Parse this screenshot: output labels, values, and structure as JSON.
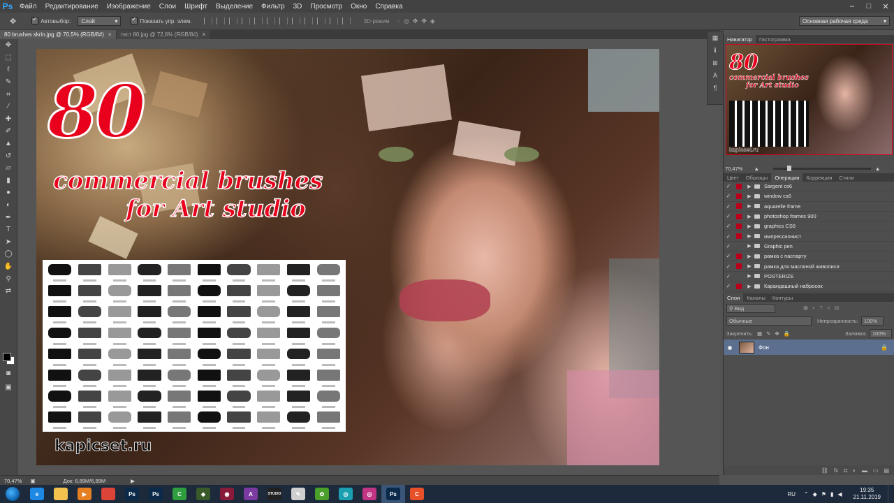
{
  "menubar": {
    "logo": "Ps",
    "items": [
      "Файл",
      "Редактирование",
      "Изображение",
      "Слои",
      "Шрифт",
      "Выделение",
      "Фильтр",
      "3D",
      "Просмотр",
      "Окно",
      "Справка"
    ],
    "controls": [
      "–",
      "□",
      "✕"
    ]
  },
  "options": {
    "autoselect_label": "Автовыбор:",
    "autoselect_value": "Слой",
    "show_controls_label": "Показать упр. элем.",
    "mode_3d": "3D-режим",
    "workspace": "Основная рабочая среда"
  },
  "tabs": [
    {
      "label": "80 brushes skrin.jpg @ 70,5% (RGB/8#)",
      "close": "×"
    },
    {
      "label": "тест 80.jpg @ 72,6% (RGB/8#)",
      "close": "×"
    }
  ],
  "artwork": {
    "big_number": "80",
    "line1": "commercial brushes",
    "line2": "for Art studio",
    "url": "kapicset.ru"
  },
  "panels": {
    "navigator_tabs": [
      "Навигатор",
      "Гистограмма"
    ],
    "navigator_zoom": "70,47%",
    "nav_thumb": {
      "number": "80",
      "line1": "commercial brushes",
      "line2": "for Art studio",
      "url": "kapicset.ru"
    },
    "actions_tabs": [
      "Цвет",
      "Образцы",
      "Операции",
      "Коррекция",
      "Стили"
    ],
    "actions": [
      {
        "label": "Sargent cs6",
        "checked": true,
        "marked": true
      },
      {
        "label": "window cs6",
        "checked": true,
        "marked": true
      },
      {
        "label": "aquarelle frame",
        "checked": true,
        "marked": true
      },
      {
        "label": "photoshop frames 900",
        "checked": true,
        "marked": true
      },
      {
        "label": "graphics CS6",
        "checked": true,
        "marked": true
      },
      {
        "label": "импрессионист",
        "checked": true,
        "marked": true
      },
      {
        "label": "Graphic pen",
        "checked": true,
        "marked": false
      },
      {
        "label": "рамка с паспарту",
        "checked": true,
        "marked": true
      },
      {
        "label": "рамка для масляной живописи",
        "checked": true,
        "marked": true
      },
      {
        "label": "POSTERIZE",
        "checked": true,
        "marked": false
      },
      {
        "label": "Карандашный набросок",
        "checked": true,
        "marked": true
      }
    ],
    "layers_tabs": [
      "Слои",
      "Каналы",
      "Контуры"
    ],
    "layer_kind": "Вид",
    "blend_mode": "Обычные",
    "opacity_label": "Непрозрачность:",
    "opacity_value": "100%",
    "lock_label": "Закрепить:",
    "fill_label": "Заливка:",
    "fill_value": "100%",
    "layer_name": "Фон"
  },
  "status": {
    "zoom": "70,47%",
    "doc": "Док: 6,89M/6,89M"
  },
  "taskbar": {
    "apps": [
      {
        "name": "ie",
        "label": "e",
        "color": "#1e88e5"
      },
      {
        "name": "explorer",
        "label": "",
        "color": "#f2c14e"
      },
      {
        "name": "media",
        "label": "▶",
        "color": "#e67e22"
      },
      {
        "name": "chrome",
        "label": "",
        "color": "#db4437"
      },
      {
        "name": "ps1",
        "label": "Ps",
        "color": "#0b2a4a"
      },
      {
        "name": "ps2",
        "label": "Ps",
        "color": "#0b2a4a"
      },
      {
        "name": "camtasia",
        "label": "C",
        "color": "#2e9e3e"
      },
      {
        "name": "app8",
        "label": "◆",
        "color": "#3a5a2a"
      },
      {
        "name": "app9",
        "label": "◉",
        "color": "#8a1a3a"
      },
      {
        "name": "app10",
        "label": "A",
        "color": "#7a3aa0"
      },
      {
        "name": "studio",
        "label": "STUDIO",
        "color": "#222222"
      },
      {
        "name": "app12",
        "label": "✎",
        "color": "#d0d0d0"
      },
      {
        "name": "app13",
        "label": "✿",
        "color": "#4aa02a"
      },
      {
        "name": "app14",
        "label": "◎",
        "color": "#1aa0b0"
      },
      {
        "name": "instagram",
        "label": "◎",
        "color": "#c13584"
      },
      {
        "name": "ps3",
        "label": "Ps",
        "color": "#0b2a4a",
        "active": true
      },
      {
        "name": "app17",
        "label": "C",
        "color": "#e8502a"
      }
    ],
    "lang": "RU",
    "time": "19:35",
    "date": "21.11.2019"
  }
}
